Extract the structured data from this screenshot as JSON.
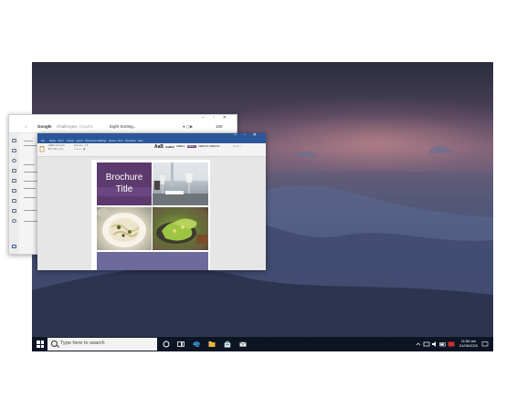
{
  "taskbar": {
    "search_placeholder": "Type here to search",
    "clock_time": "11:58 am",
    "clock_date": "01/06/2020",
    "pinned_icons": [
      "cortana-icon",
      "task-view-icon",
      "edge-icon",
      "file-explorer-icon",
      "store-icon",
      "mail-icon"
    ],
    "tray_icons": [
      "chevron-up-icon",
      "network-icon",
      "volume-icon",
      "battery-icon",
      "notification-icon"
    ]
  },
  "back_window": {
    "header_items": [
      "Google",
      "Challenges",
      "Graphs",
      "Eight Sorting..."
    ],
    "zoom": "100"
  },
  "word_window": {
    "menu_tabs": [
      "File",
      "Home",
      "Insert",
      "Design",
      "Layout",
      "References",
      "Mailings",
      "Review",
      "View",
      "Developer",
      "Help"
    ],
    "style_samples": [
      "AaB",
      "AaBbC",
      "AaBbCc",
      "AaBbCc",
      "AaBbCcD",
      "AaBbCcD"
    ]
  },
  "document": {
    "title_lines": [
      "Brochure",
      "Title"
    ]
  },
  "colors": {
    "word_blue": "#2b579a",
    "title_purple": "#5d3a6e",
    "bottom_band": "#6e6a9c",
    "taskbar": "#0d1524"
  }
}
